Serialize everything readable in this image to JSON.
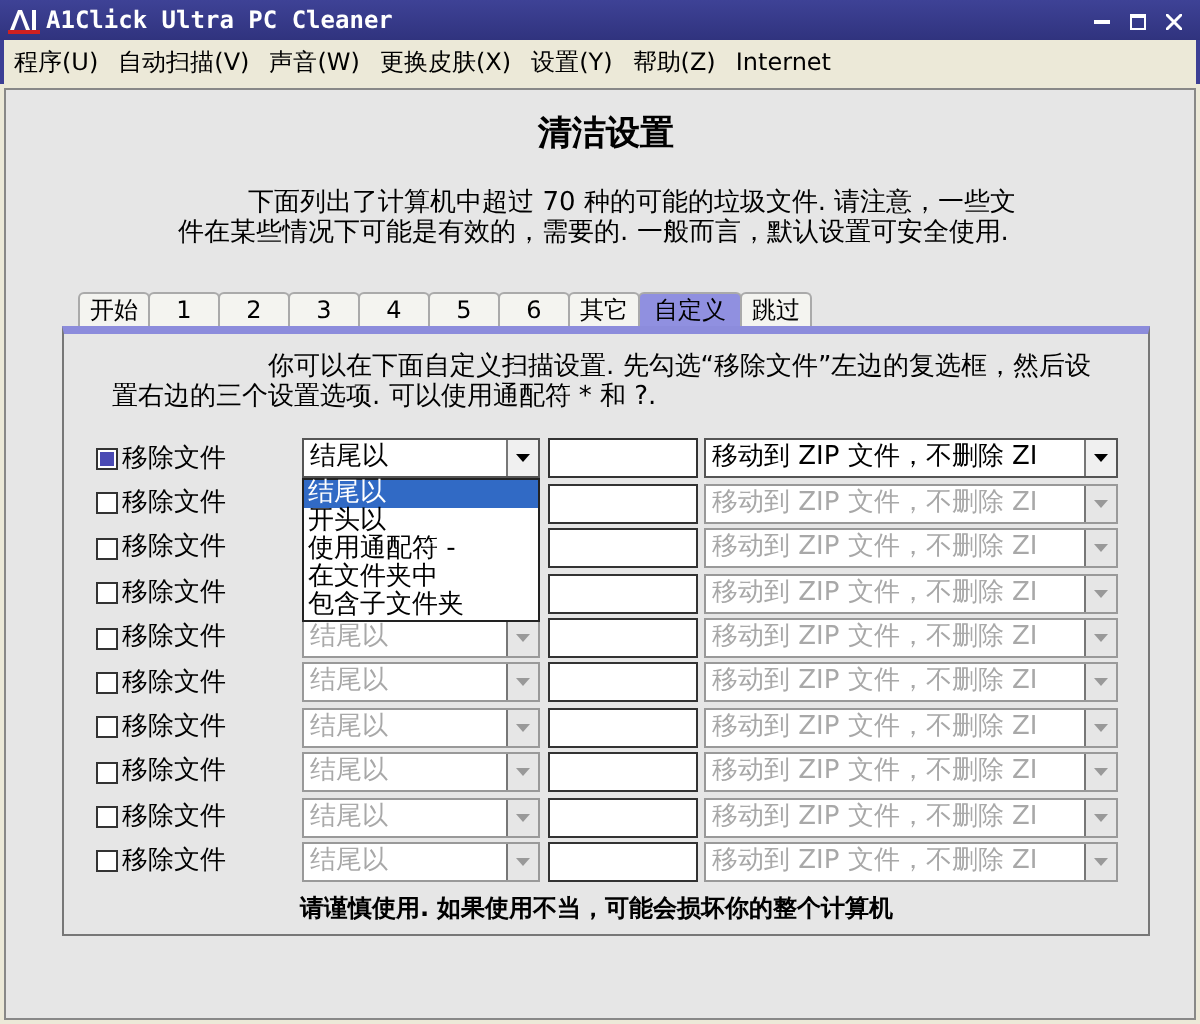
{
  "window": {
    "title": "A1Click Ultra PC Cleaner"
  },
  "menu": [
    {
      "label": "程序(U)"
    },
    {
      "label": "自动扫描(V)"
    },
    {
      "label": "声音(W)"
    },
    {
      "label": "更换皮肤(X)"
    },
    {
      "label": "设置(Y)"
    },
    {
      "label": "帮助(Z)"
    },
    {
      "label": "Internet"
    }
  ],
  "heading": "清洁设置",
  "intro": "下面列出了计算机中超过 70 种的可能的垃圾文件.  请注意，一些文件在某些情况下可能是有效的，需要的.  一般而言，默认设置可安全使用.",
  "tabs": [
    {
      "label": "开始",
      "selected": false
    },
    {
      "label": "1",
      "selected": false
    },
    {
      "label": "2",
      "selected": false
    },
    {
      "label": "3",
      "selected": false
    },
    {
      "label": "4",
      "selected": false
    },
    {
      "label": "5",
      "selected": false
    },
    {
      "label": "6",
      "selected": false
    },
    {
      "label": "其它",
      "selected": false
    },
    {
      "label": "自定义",
      "selected": true
    },
    {
      "label": "跳过",
      "selected": false
    }
  ],
  "panel_intro": "你可以在下面自定义扫描设置.  先勾选“移除文件”左边的复选框，然后设置右边的三个设置选项. 可以使用通配符 * 和 ?.",
  "rows": [
    {
      "label": "移除文件",
      "checked": true,
      "match": "结尾以",
      "action": "移动到 ZIP 文件，不删除 ZI",
      "disabled": false
    },
    {
      "label": "移除文件",
      "checked": false,
      "action": "移动到 ZIP 文件，不删除 ZI",
      "disabled": true
    },
    {
      "label": "移除文件",
      "checked": false,
      "action": "移动到 ZIP 文件，不删除 ZI",
      "disabled": true
    },
    {
      "label": "移除文件",
      "checked": false,
      "action": "移动到 ZIP 文件，不删除 ZI",
      "disabled": true
    },
    {
      "label": "移除文件",
      "checked": false,
      "match": "结尾以",
      "action": "移动到 ZIP 文件，不删除 ZI",
      "disabled": true
    },
    {
      "label": "移除文件",
      "checked": false,
      "match": "结尾以",
      "action": "移动到 ZIP 文件，不删除 ZI",
      "disabled": true
    },
    {
      "label": "移除文件",
      "checked": false,
      "match": "结尾以",
      "action": "移动到 ZIP 文件，不删除 ZI",
      "disabled": true
    },
    {
      "label": "移除文件",
      "checked": false,
      "match": "结尾以",
      "action": "移动到 ZIP 文件，不删除 ZI",
      "disabled": true
    },
    {
      "label": "移除文件",
      "checked": false,
      "match": "结尾以",
      "action": "移动到 ZIP 文件，不删除 ZI",
      "disabled": true
    },
    {
      "label": "移除文件",
      "checked": false,
      "match": "结尾以",
      "action": "移动到 ZIP 文件，不删除 ZI",
      "disabled": true
    }
  ],
  "dropdown_list": {
    "options": [
      {
        "label": "结尾以",
        "selected": true
      },
      {
        "label": "开头以",
        "selected": false
      },
      {
        "label": "使用通配符 -",
        "selected": false
      },
      {
        "label": "在文件夹中",
        "selected": false
      },
      {
        "label": "包含子文件夹",
        "selected": false
      }
    ]
  },
  "warning": "请谨慎使用.   如果使用不当，可能会损坏你的整个计算机"
}
